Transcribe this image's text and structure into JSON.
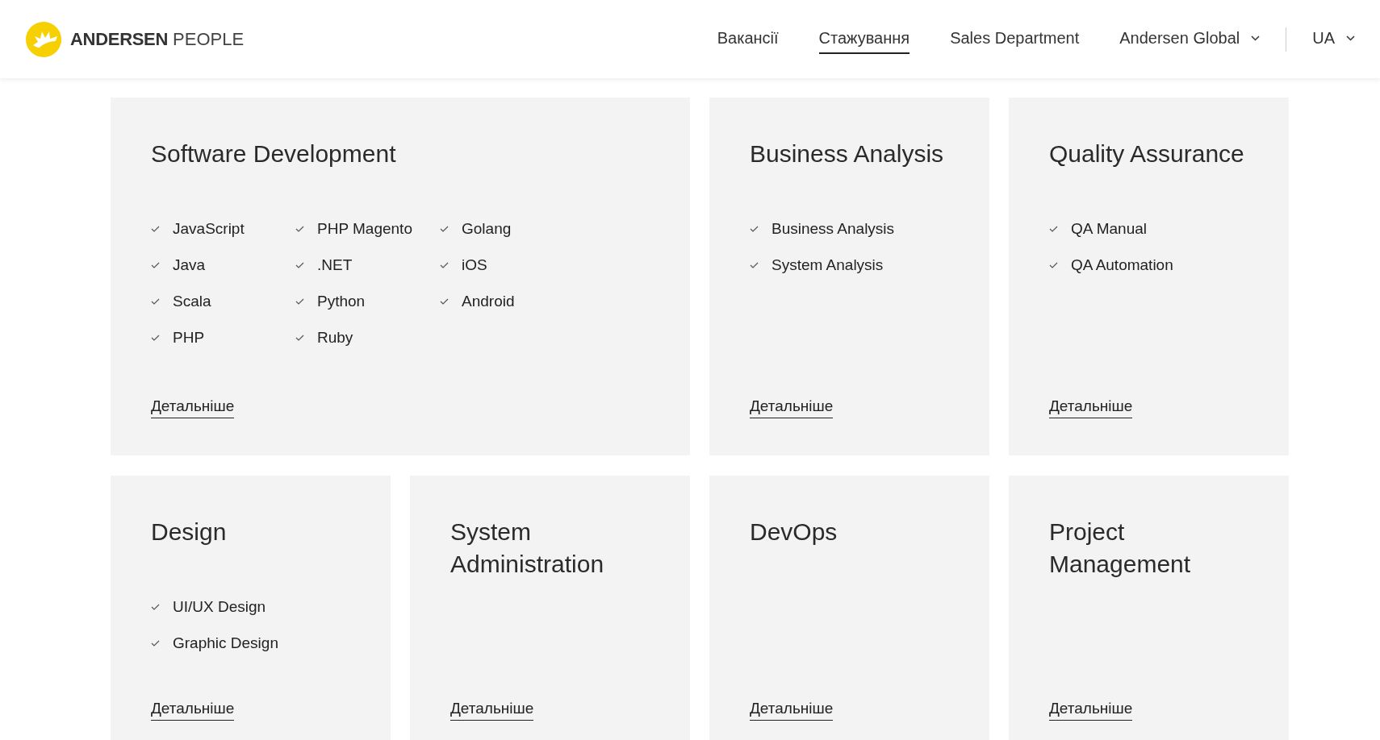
{
  "header": {
    "logo": {
      "brand": "ANDERSEN",
      "suffix": "PEOPLE"
    },
    "nav": [
      {
        "label": "Вакансії",
        "selected": false,
        "dropdown": false
      },
      {
        "label": "Стажування",
        "selected": true,
        "dropdown": false
      },
      {
        "label": "Sales Department",
        "selected": false,
        "dropdown": false
      },
      {
        "label": "Andersen Global",
        "selected": false,
        "dropdown": true
      }
    ],
    "language": {
      "label": "UA",
      "dropdown": true
    }
  },
  "cards": [
    {
      "title": "Software Development",
      "wide": true,
      "items": [
        "JavaScript",
        "Java",
        "Scala",
        "PHP",
        "PHP Magento",
        ".NET",
        "Python",
        "Ruby",
        "Golang",
        "iOS",
        "Android"
      ],
      "link": "Детальніше"
    },
    {
      "title": "Business Analysis",
      "wide": false,
      "items": [
        "Business Analysis",
        "System Analysis"
      ],
      "link": "Детальніше"
    },
    {
      "title": "Quality Assurance",
      "wide": false,
      "items": [
        "QA Manual",
        "QA Automation"
      ],
      "link": "Детальніше"
    },
    {
      "title": "Design",
      "wide": false,
      "items": [
        "UI/UX Design",
        "Graphic Design"
      ],
      "link": "Детальніше"
    },
    {
      "title": "System Administration",
      "wide": false,
      "link": "Детальніше"
    },
    {
      "title": "DevOps",
      "wide": false,
      "link": "Детальніше"
    },
    {
      "title": "Project Management",
      "wide": false,
      "link": "Детальніше"
    }
  ]
}
